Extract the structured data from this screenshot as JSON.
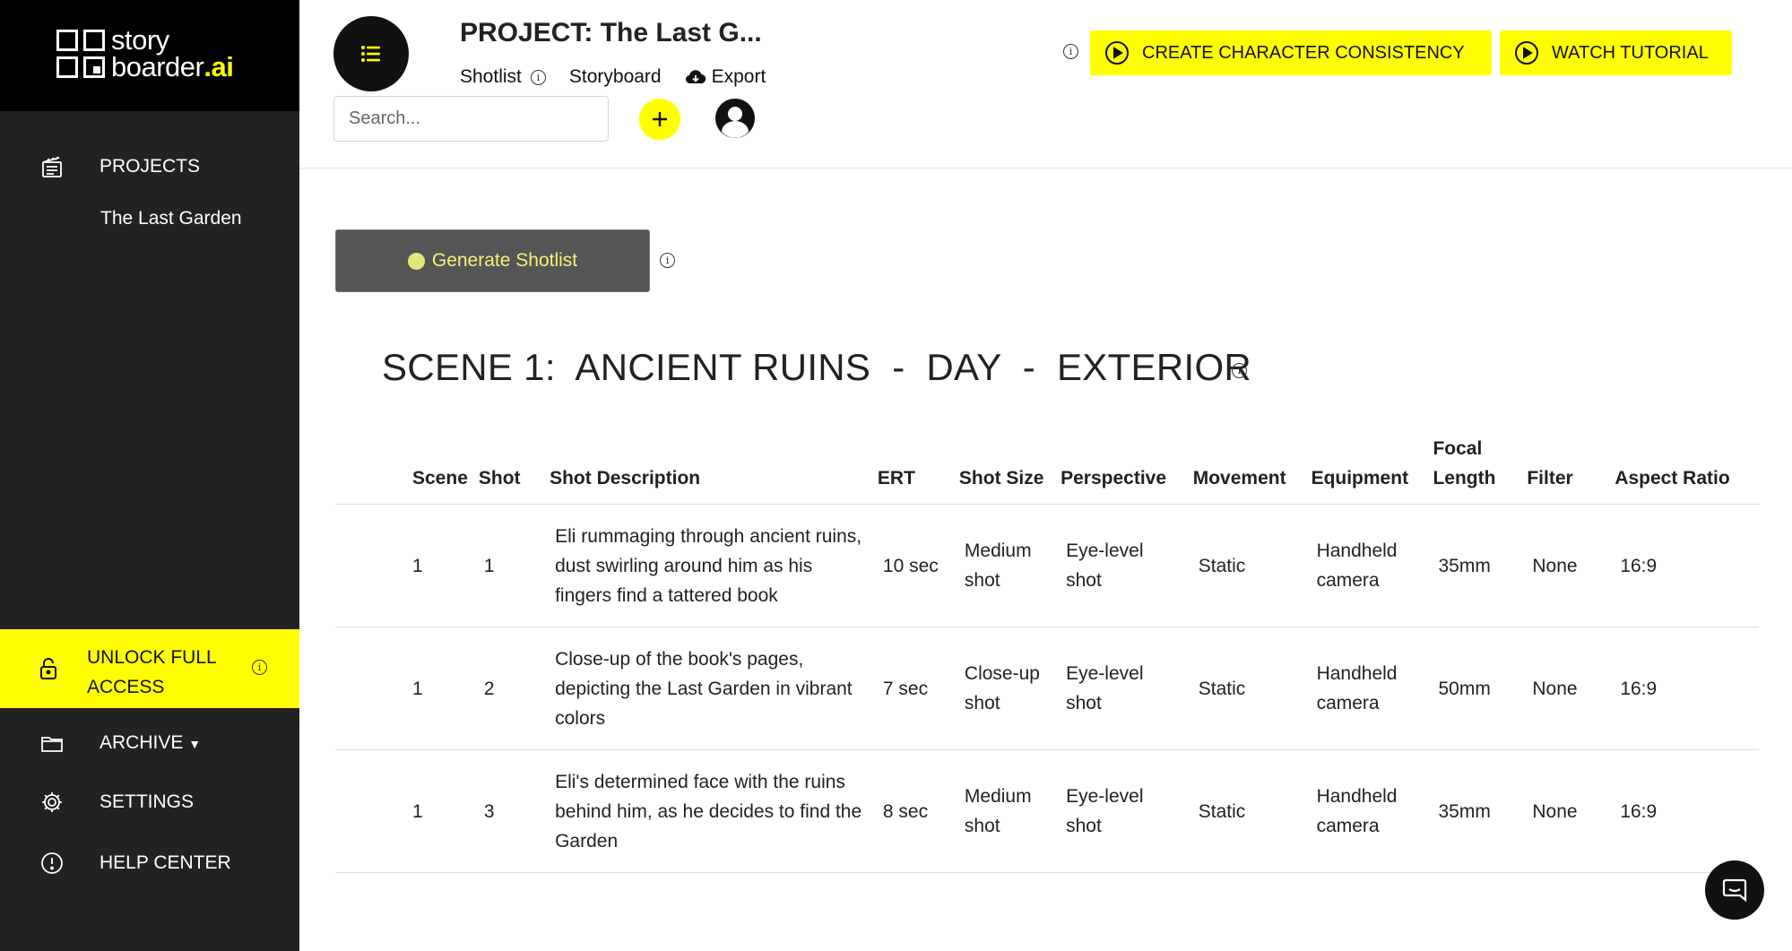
{
  "sidebar": {
    "logo": {
      "line1": "story",
      "line2_prefix": "boarder",
      "line2_suffix": ".ai"
    },
    "projects_label": "PROJECTS",
    "current_project": "The Last Garden",
    "unlock_label": "UNLOCK FULL ACCESS",
    "archive_label": "ARCHIVE",
    "settings_label": "SETTINGS",
    "help_label": "HELP CENTER",
    "accent_color": "#ffff00"
  },
  "header": {
    "project_title": "PROJECT: The Last G...",
    "tabs": [
      {
        "label": "Shotlist",
        "active": true
      },
      {
        "label": "Storyboard",
        "active": false
      },
      {
        "label": "Export",
        "active": false
      }
    ],
    "search_placeholder": "Search...",
    "create_consistency_label": "CREATE CHARACTER CONSISTENCY",
    "watch_tutorial_label": "WATCH TUTORIAL"
  },
  "main": {
    "generate_label": "Generate Shotlist",
    "scene_title": "SCENE 1:  ANCIENT RUINS  -  DAY  -  EXTERIOR",
    "columns": [
      "Scene",
      "Shot",
      "Shot Description",
      "ERT",
      "Shot Size",
      "Perspective",
      "Movement",
      "Equipment",
      "Focal Length",
      "Filter",
      "Aspect Ratio"
    ],
    "rows": [
      [
        "1",
        "1",
        "Eli rummaging through ancient ruins, dust swirling around him as his fingers find a tattered book",
        "10 sec",
        "Medium shot",
        "Eye-level shot",
        "Static",
        "Handheld camera",
        "35mm",
        "None",
        "16:9"
      ],
      [
        "1",
        "2",
        "Close-up of the book's pages, depicting the Last Garden in vibrant colors",
        "7 sec",
        "Close-up shot",
        "Eye-level shot",
        "Static",
        "Handheld camera",
        "50mm",
        "None",
        "16:9"
      ],
      [
        "1",
        "3",
        "Eli's determined face with the ruins behind him, as he decides to find the Garden",
        "8 sec",
        "Medium shot",
        "Eye-level shot",
        "Static",
        "Handheld camera",
        "35mm",
        "None",
        "16:9"
      ]
    ]
  }
}
